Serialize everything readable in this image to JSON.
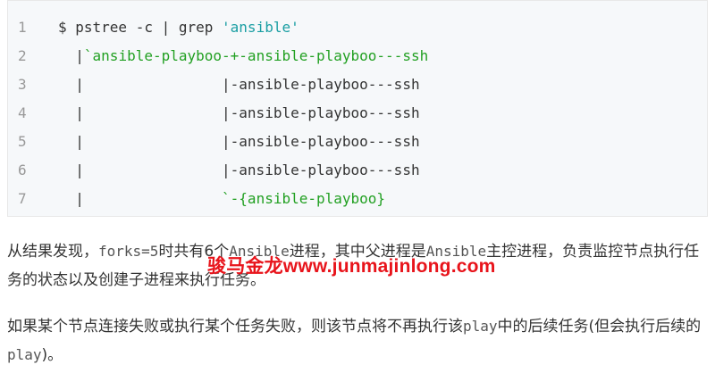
{
  "code": {
    "lines": [
      {
        "n": "1",
        "parts": [
          {
            "t": "$ pstree -c | grep ",
            "c": "tk-prompt"
          },
          {
            "t": "'ansible'",
            "c": "tk-str"
          }
        ]
      },
      {
        "n": "2",
        "parts": [
          {
            "t": "  |",
            "c": "tk-prompt"
          },
          {
            "t": "`ansible-playboo-+-ansible-playboo---ssh",
            "c": "tk-green"
          }
        ]
      },
      {
        "n": "3",
        "parts": [
          {
            "t": "  |                |",
            "c": "tk-prompt"
          },
          {
            "t": "-ansible-playboo---ssh",
            "c": "tk-prompt"
          }
        ]
      },
      {
        "n": "4",
        "parts": [
          {
            "t": "  |                |",
            "c": "tk-prompt"
          },
          {
            "t": "-ansible-playboo---ssh",
            "c": "tk-prompt"
          }
        ]
      },
      {
        "n": "5",
        "parts": [
          {
            "t": "  |                |",
            "c": "tk-prompt"
          },
          {
            "t": "-ansible-playboo---ssh",
            "c": "tk-prompt"
          }
        ]
      },
      {
        "n": "6",
        "parts": [
          {
            "t": "  |                |",
            "c": "tk-prompt"
          },
          {
            "t": "-ansible-playboo---ssh",
            "c": "tk-prompt"
          }
        ]
      },
      {
        "n": "7",
        "parts": [
          {
            "t": "  |                ",
            "c": "tk-prompt"
          },
          {
            "t": "`-{ansible-playboo}",
            "c": "tk-green"
          }
        ]
      }
    ]
  },
  "paragraphs": {
    "p1": "从结果发现，forks=5时共有6个Ansible进程，其中父进程是Ansible主控进程，负责监控节点执行任务的状态以及创建子进程来执行任务。",
    "p2": "如果某个节点连接失败或执行某个任务失败，则该节点将不再执行该play中的后续任务(但会执行后续的play)。"
  },
  "watermark": "骏马金龙www.junmajinlong.com",
  "colors": {
    "string": "#1a9ea3",
    "green": "#22a022",
    "watermark": "#e8141b",
    "code_bg": "#f6f8fa"
  }
}
